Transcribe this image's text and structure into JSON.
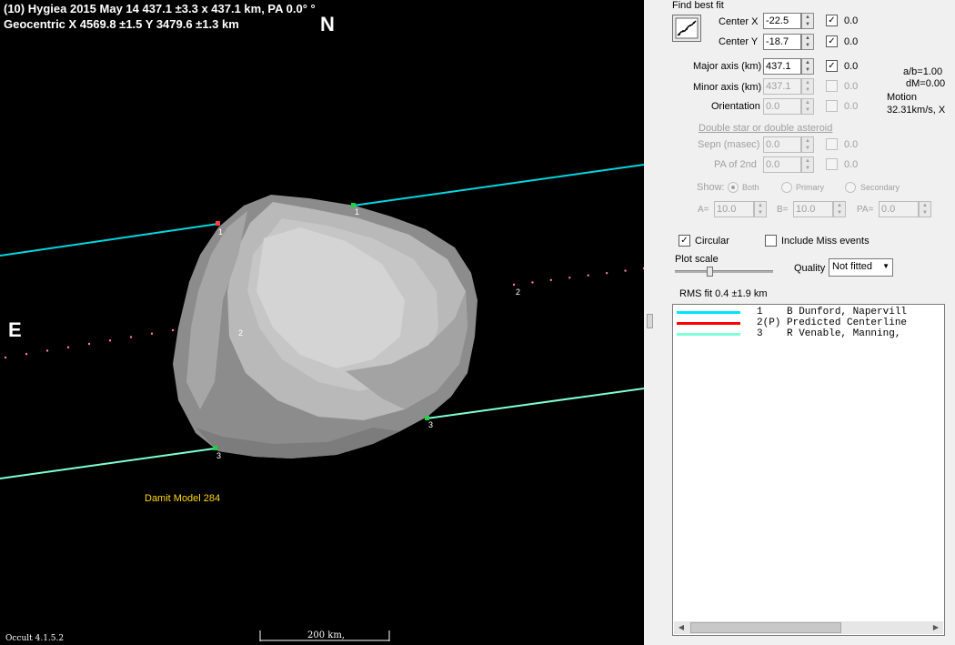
{
  "plot": {
    "title_line1": "(10) Hygiea  2015 May 14   437.1 ±3.3 x 437.1 km,  PA 0.0° °",
    "title_line2": "Geocentric  X  4569.8 ±1.5   Y 3479.6 ±1.3 km",
    "north_label": "N",
    "east_label": "E",
    "model_label": "Damit Model 284",
    "version_label": "Occult 4.1.5.2",
    "scale_label": "200 km,",
    "chord_labels": [
      "1",
      "1",
      "2",
      "2",
      "3",
      "3"
    ],
    "colors": {
      "chord_cyan": "#00d7e0",
      "chord_aqua": "#7fffd4",
      "dots": "#ff7f9f",
      "model_label": "#ffd700"
    }
  },
  "panel": {
    "find_best_fit": "Find best fit",
    "center_x": {
      "label": "Center X",
      "value": "-22.5",
      "checked": true,
      "check_value": "0.0"
    },
    "center_y": {
      "label": "Center Y",
      "value": "-18.7",
      "checked": true,
      "check_value": "0.0"
    },
    "major_axis": {
      "label": "Major axis (km)",
      "value": "437.1",
      "checked": true,
      "check_value": "0.0"
    },
    "minor_axis": {
      "label": "Minor axis (km)",
      "value": "437.1",
      "checked": false,
      "check_value": "0.0"
    },
    "orientation": {
      "label": "Orientation",
      "value": "0.0",
      "checked": false,
      "check_value": "0.0"
    },
    "ratio": "a/b=1.00",
    "dm": "dM=0.00",
    "motion_label": "Motion",
    "motion_value": "32.31km/s, X",
    "double_star_link": "Double star  or  double asteroid",
    "sepn": {
      "label": "Sepn (masec)",
      "value": "0.0",
      "check_value": "0.0"
    },
    "pa2nd": {
      "label": "PA of 2nd",
      "value": "0.0",
      "check_value": "0.0"
    },
    "show_label": "Show:",
    "show_both": "Both",
    "show_primary": "Primary",
    "show_secondary": "Secondary",
    "a_label": "A=",
    "a_value": "10.0",
    "b_label": "B=",
    "b_value": "10.0",
    "pa_label": "PA=",
    "pa_value": "0.0",
    "circular_label": "Circular",
    "circular_checked": true,
    "include_miss_label": "Include Miss events",
    "include_miss_checked": false,
    "plot_scale_label": "Plot scale",
    "plot_scale_position": 0.35,
    "quality_label": "Quality",
    "quality_value": "Not fitted",
    "rms_fit": "RMS fit 0.4 ±1.9 km",
    "observers": [
      {
        "color": "#00e5ff",
        "text": "1    B Dunford, Napervill"
      },
      {
        "color": "#ff0000",
        "text": "2(P) Predicted Centerline"
      },
      {
        "color": "#7fffd4",
        "text": "3    R Venable, Manning,"
      }
    ]
  }
}
